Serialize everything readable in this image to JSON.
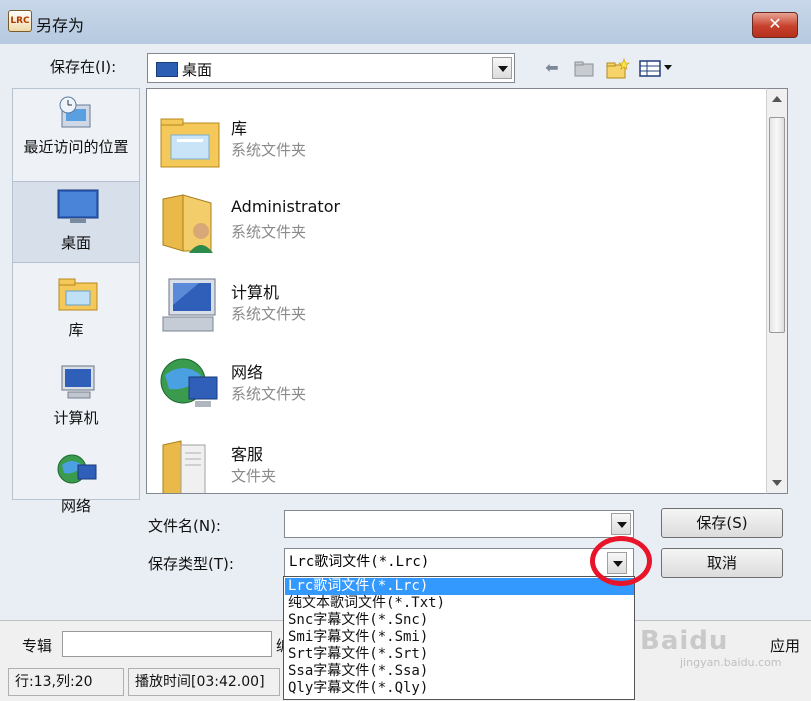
{
  "window": {
    "title": "另存为",
    "app_icon_text": "LRC",
    "close_glyph": "✕"
  },
  "save_in": {
    "label": "保存在(I):",
    "value": "桌面"
  },
  "places": [
    {
      "label": "最近访问的位置",
      "icon": "recent-places-icon"
    },
    {
      "label": "桌面",
      "icon": "desktop-icon"
    },
    {
      "label": "库",
      "icon": "libraries-icon"
    },
    {
      "label": "计算机",
      "icon": "computer-icon"
    },
    {
      "label": "网络",
      "icon": "network-icon"
    }
  ],
  "files": [
    {
      "name": "库",
      "type": "系统文件夹",
      "icon": "libraries-folder-icon"
    },
    {
      "name": "Administrator",
      "type": "系统文件夹",
      "icon": "user-folder-icon"
    },
    {
      "name": "计算机",
      "type": "系统文件夹",
      "icon": "computer-icon"
    },
    {
      "name": "网络",
      "type": "系统文件夹",
      "icon": "network-globe-icon"
    },
    {
      "name": "客服",
      "type": "文件夹",
      "icon": "folder-icon"
    }
  ],
  "filename": {
    "label": "文件名(N):",
    "value": ""
  },
  "filetype": {
    "label": "保存类型(T):",
    "value": "Lrc歌词文件(*.Lrc)"
  },
  "buttons": {
    "save": "保存(S)",
    "cancel": "取消"
  },
  "dropdown_options": [
    "Lrc歌词文件(*.Lrc)",
    "纯文本歌词文件(*.Txt)",
    "Snc字幕文件(*.Snc)",
    "Smi字幕文件(*.Smi)",
    "Srt字幕文件(*.Srt)",
    "Ssa字幕文件(*.Ssa)",
    "Qly字幕文件(*.Qly)"
  ],
  "bottom": {
    "album_label": "专辑",
    "partial_label": "编",
    "apply_label": "应用",
    "watermark": "Baidu",
    "watermark_sub": "jingyan.baidu.com",
    "status_pos": "行:13,列:20",
    "status_time": "播放时间[03:42.00]"
  },
  "colors": {
    "selection": "#3399ff",
    "highlight_circle": "#e8152a"
  }
}
